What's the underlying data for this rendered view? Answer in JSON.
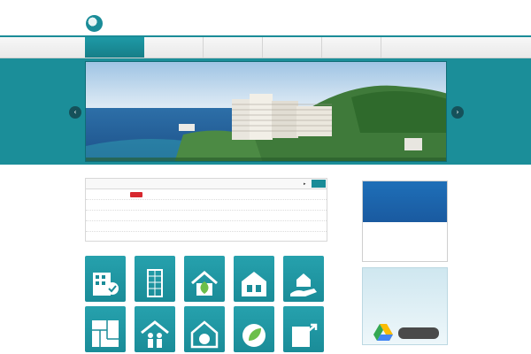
{
  "header": {
    "tagline": "",
    "logo_name": "",
    "logo_sub": ""
  },
  "nav": [
    {
      "jp": "",
      "en": "",
      "active": true
    },
    {
      "jp": "",
      "en": "",
      "active": false
    },
    {
      "jp": "",
      "en": "",
      "active": false
    },
    {
      "jp": "",
      "en": "",
      "active": false
    },
    {
      "jp": "",
      "en": "",
      "active": false
    },
    {
      "jp": "",
      "en": "",
      "active": false
    }
  ],
  "slider": {
    "prev_icon": "chevron-left-icon",
    "next_icon": "chevron-right-icon",
    "prev_glyph": "‹",
    "next_glyph": "›",
    "slide_count": 5,
    "active_slide": 1
  },
  "news": {
    "title": "",
    "more_arrow": "▸",
    "more_label": "",
    "items": [
      {
        "date": "",
        "new": true,
        "new_label": "",
        "text": ""
      },
      {
        "date": "",
        "new": false,
        "new_label": "",
        "text": ""
      },
      {
        "date": "",
        "new": false,
        "new_label": "",
        "text": ""
      },
      {
        "date": "",
        "new": false,
        "new_label": "",
        "text": ""
      },
      {
        "date": "",
        "new": false,
        "new_label": "",
        "text": ""
      }
    ]
  },
  "services": {
    "title": "",
    "tiles": [
      {
        "label": "",
        "icon": "building-check-icon"
      },
      {
        "label": "",
        "icon": "tower-grid-icon"
      },
      {
        "label": "",
        "icon": "house-leaf-icon"
      },
      {
        "label": "",
        "icon": "house-35-icon"
      },
      {
        "label": "",
        "icon": "hand-house-icon"
      },
      {
        "label": "",
        "icon": "floorplan-icon"
      },
      {
        "label": "",
        "icon": "family-house-icon"
      },
      {
        "label": "",
        "icon": "house-co2-icon"
      },
      {
        "label": "",
        "icon": "bels-leaf-icon"
      },
      {
        "label": "",
        "icon": "building-arrow-icon"
      }
    ]
  },
  "sidebar": {
    "igate": {
      "line1": "",
      "line2": "",
      "logo": "",
      "note": ""
    },
    "structural": {
      "line1": "",
      "line2": "",
      "button": ""
    }
  },
  "colors": {
    "teal": "#1a8c98",
    "band": "#1b8e99",
    "new_badge": "#d7282f",
    "link": "#1a6f8c",
    "igate_blue": "#1e6fb8",
    "structural_text": "#1a78a8"
  }
}
